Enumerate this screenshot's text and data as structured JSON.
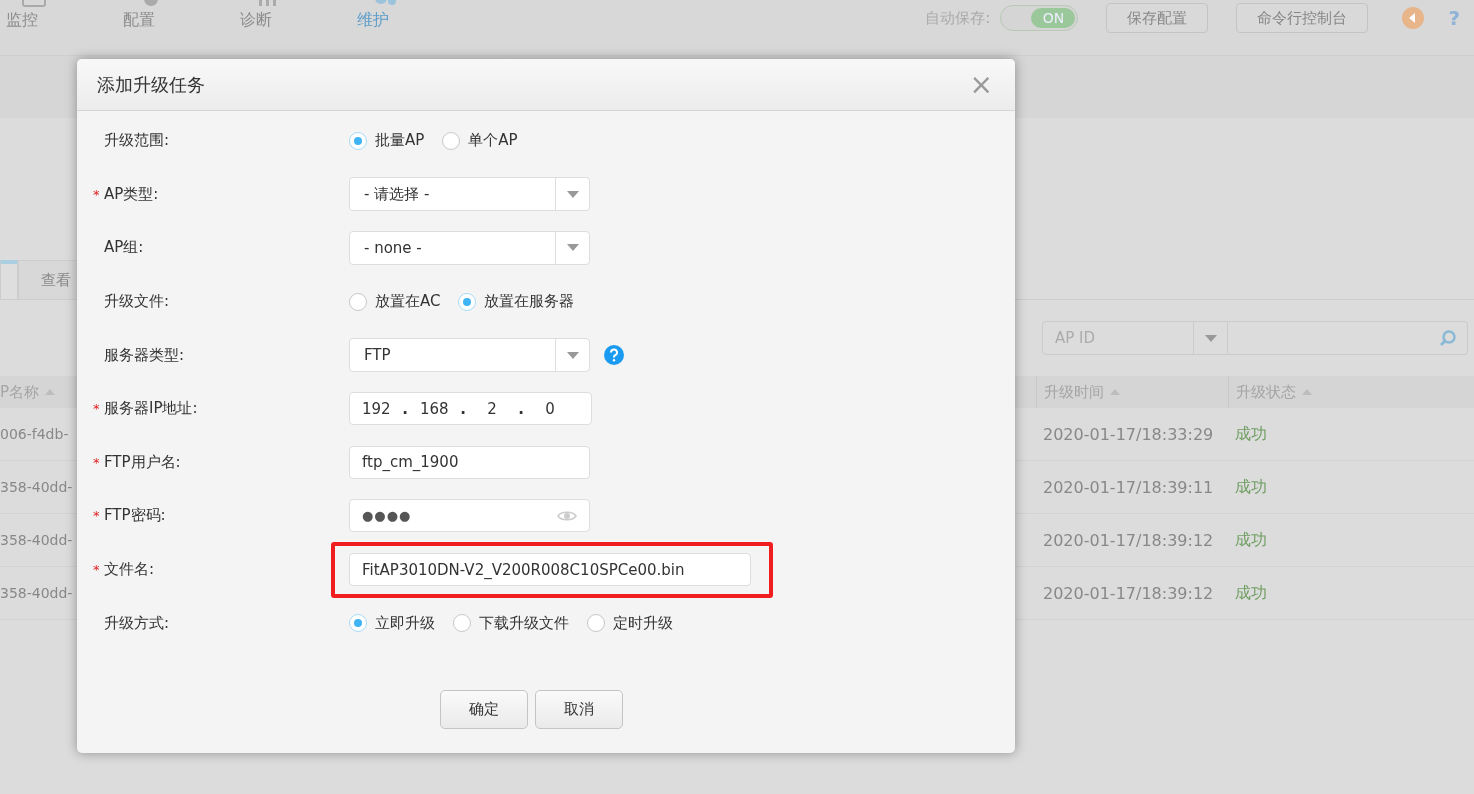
{
  "nav": {
    "items": [
      {
        "label": "监控",
        "selected": false
      },
      {
        "label": "配置",
        "selected": false
      },
      {
        "label": "诊断",
        "selected": false
      },
      {
        "label": "维护",
        "selected": true
      }
    ]
  },
  "toolbar": {
    "autosave": {
      "label": "自动保存:",
      "on": true,
      "state_text": "ON"
    },
    "buttons": [
      "保存配置",
      "命令行控制台"
    ],
    "help": "?"
  },
  "tabs": [
    {
      "selected": true
    },
    {
      "label": "查看",
      "selected": false
    }
  ],
  "filter": {
    "select": "AP ID"
  },
  "table": {
    "columns": [
      "P名称",
      "升级时间",
      "升级状态"
    ],
    "rows": [
      {
        "cells": [
          "006-f4db-",
          "2020-01-17/18:33:29",
          "成功"
        ]
      },
      {
        "cells": [
          "358-40dd-",
          "2020-01-17/18:39:11",
          "成功"
        ]
      },
      {
        "cells": [
          "358-40dd-",
          "2020-01-17/18:39:12",
          "成功"
        ]
      },
      {
        "cells": [
          "358-40dd-",
          "2020-01-17/18:39:12",
          "成功"
        ]
      }
    ]
  },
  "dialog": {
    "title": "添加升级任务",
    "close": "×",
    "required_mark": "*",
    "fields": [
      {
        "kind": "radio",
        "label": "升级范围:",
        "required": false,
        "options": [
          {
            "label": "批量AP",
            "selected": true
          },
          {
            "label": "单个AP",
            "selected": false
          }
        ]
      },
      {
        "kind": "select",
        "label": "AP类型:",
        "required": true,
        "value": "- 请选择 -"
      },
      {
        "kind": "select",
        "label": "AP组:",
        "required": false,
        "value": "- none -"
      },
      {
        "kind": "radio",
        "label": "升级文件:",
        "required": false,
        "options": [
          {
            "label": "放置在AC",
            "selected": false
          },
          {
            "label": "放置在服务器",
            "selected": true
          }
        ]
      },
      {
        "kind": "select",
        "label": "服务器类型:",
        "required": false,
        "value": "FTP",
        "help": true
      },
      {
        "kind": "ip",
        "label": "服务器IP地址:",
        "required": true,
        "separator": ".",
        "octets": [
          "192",
          "168",
          "2",
          "0"
        ]
      },
      {
        "kind": "text",
        "label": "FTP用户名:",
        "required": true,
        "value": "ftp_cm_1900"
      },
      {
        "kind": "password",
        "label": "FTP密码:",
        "required": true,
        "value": "●●●●"
      },
      {
        "kind": "filename",
        "label": "文件名:",
        "required": true,
        "value": "FitAP3010DN-V2_V200R008C10SPCe00.bin",
        "highlighted": true
      },
      {
        "kind": "radio",
        "label": "升级方式:",
        "required": false,
        "options": [
          {
            "label": "立即升级",
            "selected": true
          },
          {
            "label": "下载升级文件",
            "selected": false
          },
          {
            "label": "定时升级",
            "selected": false
          }
        ]
      }
    ],
    "buttons": [
      "确定",
      "取消"
    ]
  }
}
